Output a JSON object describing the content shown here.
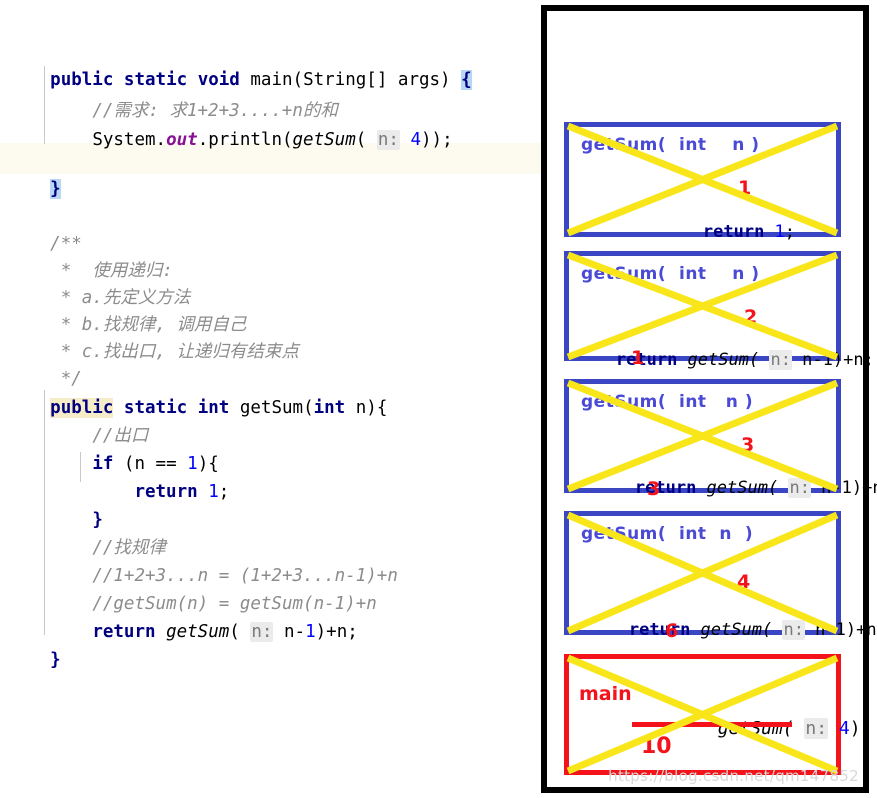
{
  "editor": {
    "lines": [
      {
        "id": "l1",
        "text": "public static void main(String[] args) {"
      },
      {
        "id": "l2",
        "text": "    //需求: 求1+2+3....+n的和"
      },
      {
        "id": "l3",
        "text": "    System.out.println(getSum( n: 4));"
      },
      {
        "id": "l4",
        "text": ""
      },
      {
        "id": "l5",
        "text": "}"
      },
      {
        "id": "l6",
        "text": ""
      },
      {
        "id": "l7",
        "text": "/**"
      },
      {
        "id": "l8",
        "text": " *  使用递归:"
      },
      {
        "id": "l9",
        "text": " * a.先定义方法"
      },
      {
        "id": "l10",
        "text": " * b.找规律, 调用自己"
      },
      {
        "id": "l11",
        "text": " * c.找出口, 让递归有结束点"
      },
      {
        "id": "l12",
        "text": " */"
      },
      {
        "id": "l13",
        "text": "public static int getSum(int n){"
      },
      {
        "id": "l14",
        "text": "    //出口"
      },
      {
        "id": "l15",
        "text": "    if (n == 1){"
      },
      {
        "id": "l16",
        "text": "        return 1;"
      },
      {
        "id": "l17",
        "text": "    }"
      },
      {
        "id": "l18",
        "text": "    //找规律"
      },
      {
        "id": "l19",
        "text": "    //1+2+3...n = (1+2+3...n-1)+n"
      },
      {
        "id": "l20",
        "text": "    //getSum(n) = getSum(n-1)+n"
      },
      {
        "id": "l21",
        "text": "    return getSum( n: n-1)+n;"
      },
      {
        "id": "l22",
        "text": "}"
      }
    ],
    "tokens": {
      "kw_public": "public",
      "kw_static": "static",
      "kw_void": "void",
      "kw_int": "int",
      "kw_if": "if",
      "kw_return": "return",
      "main": "main",
      "string_args": "(String[] args) ",
      "brace_open": "{",
      "brace_close": "}",
      "comment_need": "//需求: 求1+2+3....+n的和",
      "sysout_system": "System.",
      "sysout_out": "out",
      "sysout_println": ".println(",
      "getsum": "getSum",
      "paren_open": "(",
      "hint_n": "n:",
      "val_4": "4",
      "tail_4": "));",
      "doc_open": "/**",
      "doc_l1": " *  使用递归:",
      "doc_l2": " * a.先定义方法",
      "doc_l3": " * b.找规律, 调用自己",
      "doc_l4": " * c.找出口, 让递归有结束点",
      "doc_close": " */",
      "sig_tail": "(int n){",
      "comment_exit": "//出口",
      "if_cond_a": " (n == ",
      "if_one": "1",
      "if_cond_b": "){",
      "ret_one": "1",
      "semi": ";",
      "brace_close_ind": "}",
      "comment_rule": "//找规律",
      "comment_formula1": "//1+2+3...n = (1+2+3...n-1)+n",
      "comment_formula2": "//getSum(n) = getSum(n-1)+n",
      "ret_nm1_a": " n-",
      "ret_one_b": "1",
      "ret_nm1_b": ")+n;"
    }
  },
  "panel": {
    "watermark": "https://blog.csdn.net/qm147852",
    "frames": [
      {
        "id": "frame1",
        "kind": "blue",
        "signature": "getSum(  int    n )",
        "body_kind": "return_one",
        "body_prefix": "return ",
        "body_value": "1",
        "body_suffix": ";",
        "number_mid": "1",
        "number_bottom": ""
      },
      {
        "id": "frame2",
        "kind": "blue",
        "signature": "getSum(  int    n )",
        "body_kind": "return_call",
        "body_prefix": "return ",
        "body_call": "getSum(",
        "body_hint": "n:",
        "body_arg": " n-1",
        "body_suffix": ")+n;",
        "number_mid": "2",
        "number_bottom": "1"
      },
      {
        "id": "frame3",
        "kind": "blue",
        "signature": "getSum(  int   n )",
        "body_kind": "return_call",
        "body_prefix": "return ",
        "body_call": "getSum(",
        "body_hint": "n:",
        "body_arg": " n-1",
        "body_suffix": ")+n;",
        "number_mid": "3",
        "number_bottom": "3"
      },
      {
        "id": "frame4",
        "kind": "blue",
        "signature": "getSum(  int  n  )",
        "body_kind": "return_call",
        "body_prefix": "return ",
        "body_call": "getSum(",
        "body_hint": "n:",
        "body_arg": " n-1",
        "body_suffix": ")+n;",
        "number_mid": "4",
        "number_bottom": "6"
      },
      {
        "id": "frame5",
        "kind": "red",
        "label": "main",
        "call_text": "getSum(",
        "call_hint": "n:",
        "call_arg": " 4",
        "call_suffix": ")",
        "number_mid": "10"
      }
    ]
  }
}
